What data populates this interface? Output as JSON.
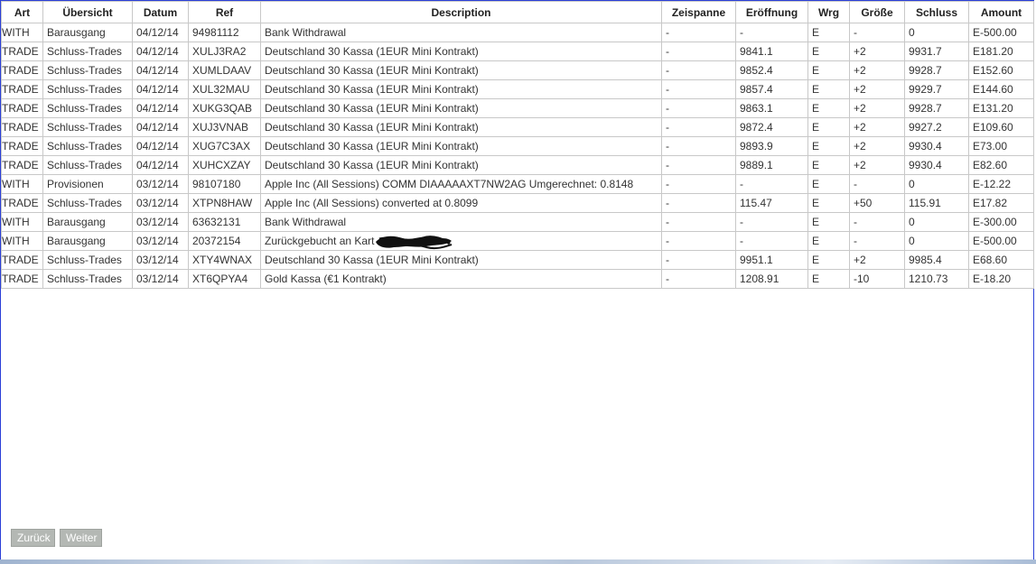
{
  "table": {
    "columns": [
      "Art",
      "Übersicht",
      "Datum",
      "Ref",
      "Description",
      "Zeispanne",
      "Eröffnung",
      "Wrg",
      "Größe",
      "Schluss",
      "Amount"
    ],
    "rows": [
      {
        "art": "WITH",
        "uebersicht": "Barausgang",
        "datum": "04/12/14",
        "ref": "94981112",
        "description": "Bank Withdrawal",
        "zeispanne": "-",
        "eroeffnung": "-",
        "wrg": "E",
        "groesse": "-",
        "schluss": "0",
        "amount": "E-500.00"
      },
      {
        "art": "TRADE",
        "uebersicht": "Schluss-Trades",
        "datum": "04/12/14",
        "ref": "XULJ3RA2",
        "description": "Deutschland 30 Kassa (1EUR Mini Kontrakt)",
        "zeispanne": "-",
        "eroeffnung": "9841.1",
        "wrg": "E",
        "groesse": "+2",
        "schluss": "9931.7",
        "amount": "E181.20"
      },
      {
        "art": "TRADE",
        "uebersicht": "Schluss-Trades",
        "datum": "04/12/14",
        "ref": "XUMLDAAV",
        "description": "Deutschland 30 Kassa (1EUR Mini Kontrakt)",
        "zeispanne": "-",
        "eroeffnung": "9852.4",
        "wrg": "E",
        "groesse": "+2",
        "schluss": "9928.7",
        "amount": "E152.60"
      },
      {
        "art": "TRADE",
        "uebersicht": "Schluss-Trades",
        "datum": "04/12/14",
        "ref": "XUL32MAU",
        "description": "Deutschland 30 Kassa (1EUR Mini Kontrakt)",
        "zeispanne": "-",
        "eroeffnung": "9857.4",
        "wrg": "E",
        "groesse": "+2",
        "schluss": "9929.7",
        "amount": "E144.60"
      },
      {
        "art": "TRADE",
        "uebersicht": "Schluss-Trades",
        "datum": "04/12/14",
        "ref": "XUKG3QAB",
        "description": "Deutschland 30 Kassa (1EUR Mini Kontrakt)",
        "zeispanne": "-",
        "eroeffnung": "9863.1",
        "wrg": "E",
        "groesse": "+2",
        "schluss": "9928.7",
        "amount": "E131.20"
      },
      {
        "art": "TRADE",
        "uebersicht": "Schluss-Trades",
        "datum": "04/12/14",
        "ref": "XUJ3VNAB",
        "description": "Deutschland 30 Kassa (1EUR Mini Kontrakt)",
        "zeispanne": "-",
        "eroeffnung": "9872.4",
        "wrg": "E",
        "groesse": "+2",
        "schluss": "9927.2",
        "amount": "E109.60"
      },
      {
        "art": "TRADE",
        "uebersicht": "Schluss-Trades",
        "datum": "04/12/14",
        "ref": "XUG7C3AX",
        "description": "Deutschland 30 Kassa (1EUR Mini Kontrakt)",
        "zeispanne": "-",
        "eroeffnung": "9893.9",
        "wrg": "E",
        "groesse": "+2",
        "schluss": "9930.4",
        "amount": "E73.00"
      },
      {
        "art": "TRADE",
        "uebersicht": "Schluss-Trades",
        "datum": "04/12/14",
        "ref": "XUHCXZAY",
        "description": "Deutschland 30 Kassa (1EUR Mini Kontrakt)",
        "zeispanne": "-",
        "eroeffnung": "9889.1",
        "wrg": "E",
        "groesse": "+2",
        "schluss": "9930.4",
        "amount": "E82.60"
      },
      {
        "art": "WITH",
        "uebersicht": "Provisionen",
        "datum": "03/12/14",
        "ref": "98107180",
        "description": "Apple Inc (All Sessions) COMM DIAAAAAXT7NW2AG Umgerechnet: 0.8148",
        "zeispanne": "-",
        "eroeffnung": "-",
        "wrg": "E",
        "groesse": "-",
        "schluss": "0",
        "amount": "E-12.22"
      },
      {
        "art": "TRADE",
        "uebersicht": "Schluss-Trades",
        "datum": "03/12/14",
        "ref": "XTPN8HAW",
        "description": "Apple Inc (All Sessions) converted at 0.8099",
        "zeispanne": "-",
        "eroeffnung": "115.47",
        "wrg": "E",
        "groesse": "+50",
        "schluss": "115.91",
        "amount": "E17.82"
      },
      {
        "art": "WITH",
        "uebersicht": "Barausgang",
        "datum": "03/12/14",
        "ref": "63632131",
        "description": "Bank Withdrawal",
        "zeispanne": "-",
        "eroeffnung": "-",
        "wrg": "E",
        "groesse": "-",
        "schluss": "0",
        "amount": "E-300.00"
      },
      {
        "art": "WITH",
        "uebersicht": "Barausgang",
        "datum": "03/12/14",
        "ref": "20372154",
        "description": "Zurückgebucht an Kart",
        "zeispanne": "-",
        "eroeffnung": "-",
        "wrg": "E",
        "groesse": "-",
        "schluss": "0",
        "amount": "E-500.00"
      },
      {
        "art": "TRADE",
        "uebersicht": "Schluss-Trades",
        "datum": "03/12/14",
        "ref": "XTY4WNAX",
        "description": "Deutschland 30 Kassa (1EUR Mini Kontrakt)",
        "zeispanne": "-",
        "eroeffnung": "9951.1",
        "wrg": "E",
        "groesse": "+2",
        "schluss": "9985.4",
        "amount": "E68.60"
      },
      {
        "art": "TRADE",
        "uebersicht": "Schluss-Trades",
        "datum": "03/12/14",
        "ref": "XT6QPYA4",
        "description": "Gold Kassa (€1 Kontrakt)",
        "zeispanne": "-",
        "eroeffnung": "1208.91",
        "wrg": "E",
        "groesse": "-10",
        "schluss": "1210.73",
        "amount": "E-18.20"
      }
    ]
  },
  "pagination": {
    "back_label": "Zurück",
    "next_label": "Weiter"
  },
  "colors": {
    "frame_border": "#2a3fd8",
    "grid_line": "#c8c8c8",
    "button_bg": "#b4b8b4"
  }
}
